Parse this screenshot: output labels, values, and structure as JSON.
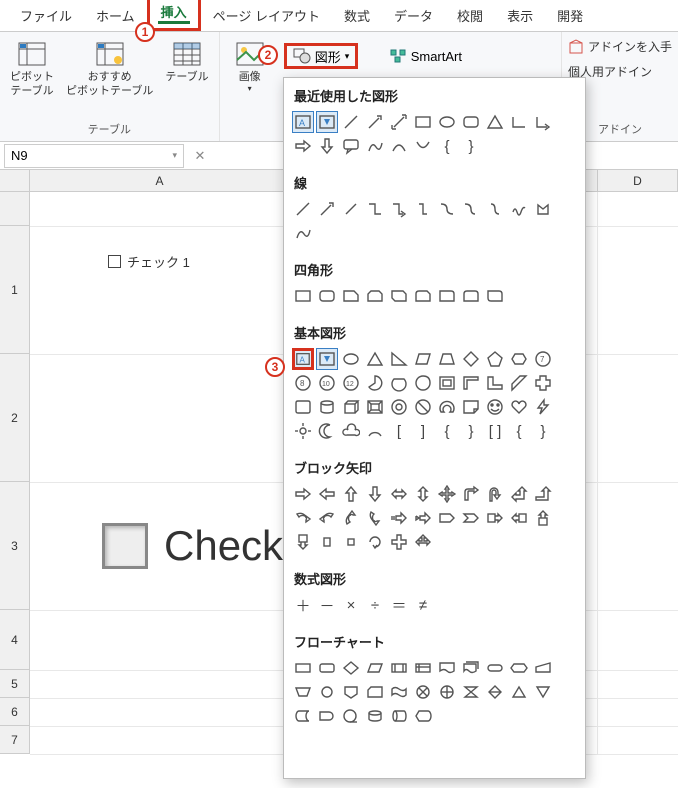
{
  "tabs": {
    "file": "ファイル",
    "home": "ホーム",
    "insert": "挿入",
    "page_layout": "ページ レイアウト",
    "formulas": "数式",
    "data": "データ",
    "review": "校閲",
    "view": "表示",
    "developer": "開発"
  },
  "ribbon": {
    "pivot_table": "ピボット\nテーブル",
    "recommended_pivot": "おすすめ\nピボットテーブル",
    "table": "テーブル",
    "tables_group": "テーブル",
    "illustrations": "画像",
    "shapes": "図形",
    "smartart": "SmartArt",
    "get_addins": "アドインを入手",
    "my_addins": "個人用アドイン",
    "addins_group": "アドイン"
  },
  "name_box": {
    "value": "N9"
  },
  "columns": {
    "A": "A",
    "D": "D"
  },
  "rows": [
    "1",
    "2",
    "3",
    "4",
    "5",
    "6",
    "7"
  ],
  "checkbox_small": {
    "label": "チェック 1"
  },
  "checkbox_large": {
    "label": "Check"
  },
  "shapes_panel": {
    "recent": "最近使用した図形",
    "lines": "線",
    "rectangles": "四角形",
    "basic_shapes": "基本図形",
    "block_arrows": "ブロック矢印",
    "equation": "数式図形",
    "flowchart": "フローチャート"
  },
  "badges": {
    "one": "1",
    "two": "2",
    "three": "3"
  }
}
